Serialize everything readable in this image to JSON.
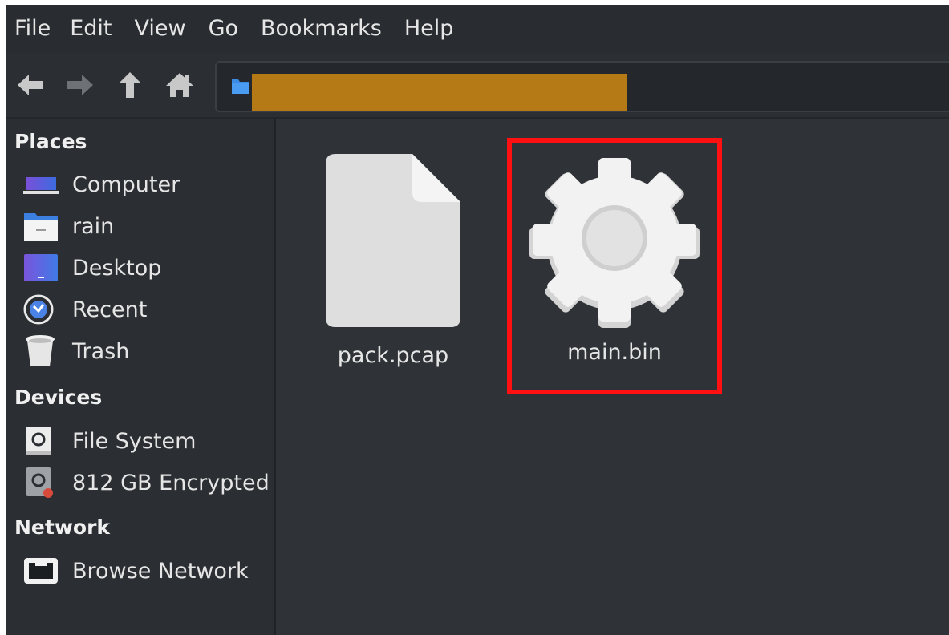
{
  "menubar": {
    "items": [
      {
        "label": "File"
      },
      {
        "label": "Edit"
      },
      {
        "label": "View"
      },
      {
        "label": "Go"
      },
      {
        "label": "Bookmarks"
      },
      {
        "label": "Help"
      }
    ]
  },
  "toolbar": {
    "buttons": [
      "back-arrow-icon",
      "forward-arrow-icon",
      "up-arrow-icon",
      "home-icon"
    ],
    "path_crumb_color": "#b57a16"
  },
  "sidebar": {
    "places_heading": "Places",
    "places": [
      {
        "label": "Computer",
        "icon": "computer-icon"
      },
      {
        "label": "rain",
        "icon": "home-folder-icon"
      },
      {
        "label": "Desktop",
        "icon": "desktop-icon"
      },
      {
        "label": "Recent",
        "icon": "recent-icon"
      },
      {
        "label": "Trash",
        "icon": "trash-icon"
      }
    ],
    "devices_heading": "Devices",
    "devices": [
      {
        "label": "File System",
        "icon": "drive-icon"
      },
      {
        "label": "812 GB Encrypted",
        "icon": "encrypted-drive-icon"
      }
    ],
    "network_heading": "Network",
    "network": [
      {
        "label": "Browse Network",
        "icon": "network-icon"
      }
    ]
  },
  "files": [
    {
      "name": "pack.pcap",
      "icon": "document-icon"
    },
    {
      "name": "main.bin",
      "icon": "gear-icon"
    }
  ],
  "highlight_color": "#ff1111"
}
